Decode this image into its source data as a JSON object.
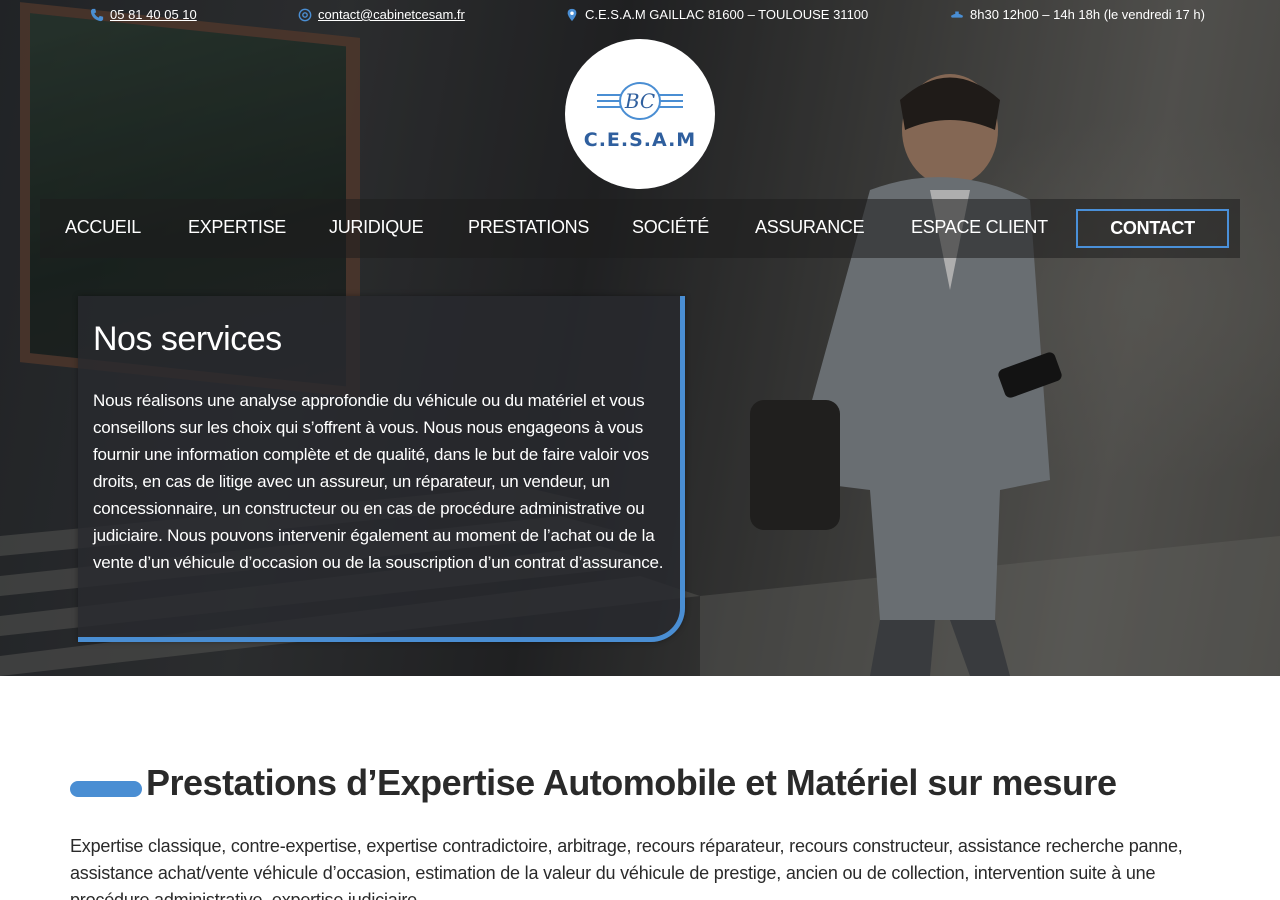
{
  "topbar": {
    "phone": "05 81 40 05 10",
    "email": "contact@cabinetcesam.fr",
    "address": "C.E.S.A.M GAILLAC 81600 – TOULOUSE 31100",
    "hours": "8h30 12h00 – 14h 18h (le vendredi 17 h)",
    "icons": [
      "phone-icon",
      "at-icon",
      "map-pin-icon",
      "clock-icon"
    ]
  },
  "logo": {
    "monogram": "BC",
    "name": "C.E.S.A.M"
  },
  "nav": {
    "items": [
      "ACCUEIL",
      "EXPERTISE",
      "JURIDIQUE",
      "PRESTATIONS",
      "SOCIÉTÉ",
      "ASSURANCE",
      "ESPACE CLIENT"
    ],
    "contact": "CONTACT"
  },
  "services": {
    "title": "Nos services",
    "text": "Nous réalisons une analyse approfondie du véhicule ou du matériel et vous conseillons sur les choix qui s’offrent à vous. Nous nous engageons à vous fournir une information complète et de qualité, dans le but de faire valoir vos droits, en cas de litige avec un assureur, un réparateur, un vendeur, un concessionnaire, un constructeur ou en cas de procédure administrative ou judiciaire. Nous pouvons intervenir également au moment de l’achat ou de la vente d’un véhicule d’occasion ou de la souscription d’un contrat d’assurance."
  },
  "prestations": {
    "title": "Prestations d’Expertise Automobile et Matériel sur mesure",
    "text": "Expertise classique, contre-expertise, expertise contradictoire, arbitrage, recours réparateur, recours constructeur, assistance recherche panne, assistance achat/vente véhicule d’occasion, estimation de la valeur du véhicule de prestige, ancien ou de collection, intervention suite à une procédure administrative, expertise judiciaire."
  },
  "colors": {
    "accent": "#4a8ed3",
    "logo_text": "#2f5f9e",
    "heading": "#2a2a2a"
  }
}
